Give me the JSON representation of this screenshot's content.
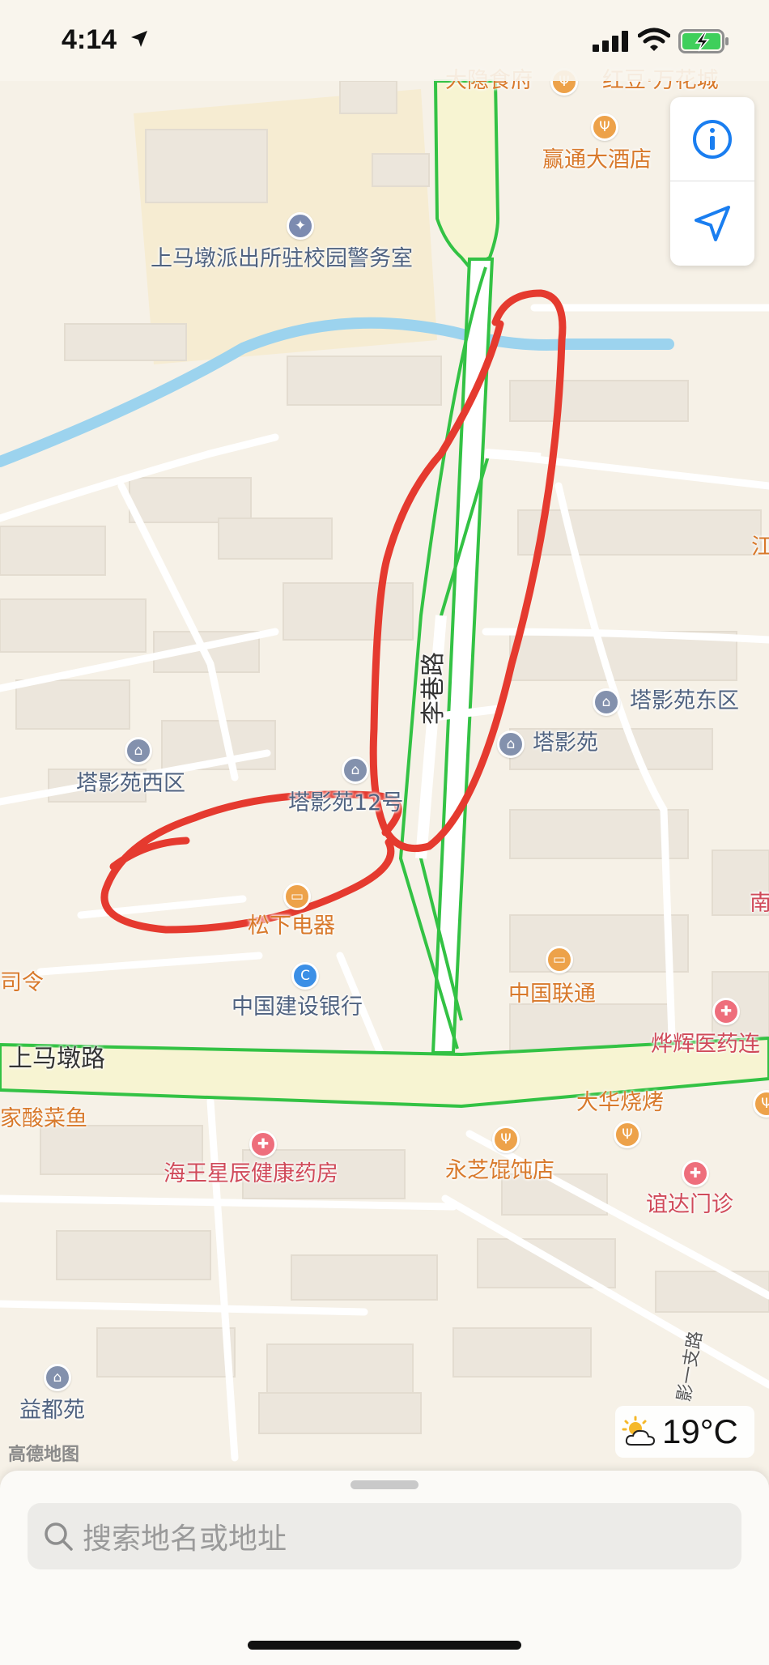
{
  "status_bar": {
    "time": "4:14",
    "icons": [
      "location-arrow-icon",
      "signal-icon",
      "wifi-icon",
      "battery-charging-icon"
    ]
  },
  "map": {
    "provider_watermark": "高德地图",
    "poi_labels": {
      "police_station": "上马墩派出所驻校园警务室",
      "hotel": "赢通大酒店",
      "top_left_cut": "大隐食府",
      "top_right_cut": "红豆·万花城",
      "jiang_cut": "江",
      "tayingyuan_east": "塔影苑东区",
      "tayingyuan": "塔影苑",
      "tayingyuan_west": "塔影苑西区",
      "tayingyuan_12": "塔影苑12号",
      "panasonic": "松下电器",
      "ccb": "中国建设银行",
      "unicom": "中国联通",
      "nan_cut": "南",
      "siling_cut": "司令",
      "hospital_cut": "烨辉医药连",
      "suancaiyu_cut": "家酸菜鱼",
      "bbq": "大华烧烤",
      "pharmacy": "海王星辰健康药房",
      "wonton": "永芝馄饨店",
      "clinic": "谊达门诊",
      "yiduyuan": "益都苑"
    },
    "road_labels": {
      "lixiang_road": "李巷路",
      "shangmadun_road": "上马墩路",
      "branch_road": "影一支路"
    },
    "colors": {
      "road_fill": "#f7f4d2",
      "road_border": "#33c244",
      "river": "#9cd3ee",
      "annotation": "#e53a2f",
      "poi_text_blue": "#4f6280",
      "poi_text_orange": "#d8792b",
      "poi_text_red": "#d04a5a"
    }
  },
  "controls": {
    "info_icon": "info-icon",
    "locate_icon": "navigation-arrow-icon"
  },
  "weather": {
    "icon": "partly-sunny-icon",
    "temperature": "19°C"
  },
  "bottom_sheet": {
    "search_placeholder": "搜索地名或地址",
    "search_icon": "search-icon"
  }
}
